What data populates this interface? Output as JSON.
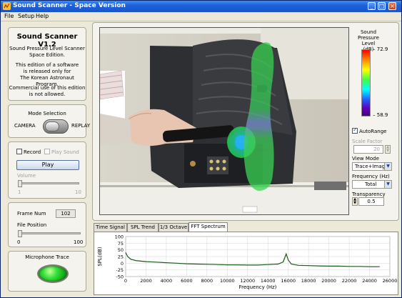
{
  "window": {
    "title": "Sound Scanner - Space Version"
  },
  "menu": [
    "File",
    "Setup",
    "Help"
  ],
  "about": {
    "heading": "Sound Scanner V1.2",
    "para1": "Sound Pressure Level Scanner\nSpace Edition.",
    "para2": "This edition of a software\nis released only for\nThe Korean Astronaut Program.",
    "para3": "Commercial use of this edition\nis not allowed."
  },
  "mode": {
    "title": "Mode Selection",
    "left": "CAMERA",
    "right": "REPLAY",
    "selected": "CAMERA"
  },
  "playback": {
    "record_label": "Record",
    "play_sound_label": "Play Sound",
    "play_button": "Play",
    "volume_label": "Volume",
    "volume_min": "1",
    "volume_max": "10",
    "volume_level": 0
  },
  "frame": {
    "frame_num_label": "Frame Num",
    "frame_num_value": "102",
    "file_position_label": "File Position",
    "pos_min": "0",
    "pos_max": "100",
    "position_level": 0
  },
  "mic": {
    "label": "Microphone Trace",
    "status_color": "#33dd33"
  },
  "colorbar": {
    "title": "Sound\nPressure\nLevel (dB)",
    "max": "72.9",
    "min": "58.9"
  },
  "controls": {
    "autorange_label": "AutoRange",
    "autorange_checked": true,
    "scale_factor_label": "Scale Factor",
    "scale_factor_value": "20",
    "view_mode_label": "View Mode",
    "view_mode_value": "Trace+Image",
    "frequency_label": "Frequency (Hz)",
    "frequency_value": "Total",
    "transparency_label": "Transparency",
    "transparency_value": "0.5"
  },
  "tabs": [
    {
      "label": "Time Signal",
      "active": false
    },
    {
      "label": "SPL Trend",
      "active": false
    },
    {
      "label": "1/3 Octave",
      "active": false
    },
    {
      "label": "FFT Spectrum",
      "active": true
    }
  ],
  "chart_data": {
    "type": "line",
    "xlabel": "Frequency (Hz)",
    "ylabel": "SPL(dB)",
    "xlim": [
      0,
      26000
    ],
    "ylim": [
      -50,
      100
    ],
    "xticks": [
      0,
      2000,
      4000,
      6000,
      8000,
      10000,
      12000,
      14000,
      16000,
      18000,
      20000,
      22000,
      24000,
      26000
    ],
    "yticks": [
      -50,
      -25,
      0,
      25,
      50,
      75,
      100
    ],
    "grid": true,
    "line_color": "#1a5c1a",
    "series": [
      {
        "x": [
          0,
          200,
          500,
          1000,
          2000,
          3000,
          4000,
          5000,
          6000,
          7000,
          8000,
          9000,
          10000,
          11000,
          12000,
          13000,
          14000,
          15000,
          15500,
          15800,
          16000,
          16300,
          17000,
          18000,
          19000,
          20000,
          21000,
          22000,
          23000,
          24000,
          25000
        ],
        "y": [
          40,
          25,
          15,
          10,
          6,
          4,
          2,
          0,
          -2,
          -3,
          -4,
          -5,
          -6,
          -6,
          -7,
          -7,
          -5,
          -3,
          5,
          35,
          12,
          -3,
          -8,
          -9,
          -10,
          -11,
          -11,
          -12,
          -12,
          -13,
          -13
        ]
      }
    ]
  }
}
